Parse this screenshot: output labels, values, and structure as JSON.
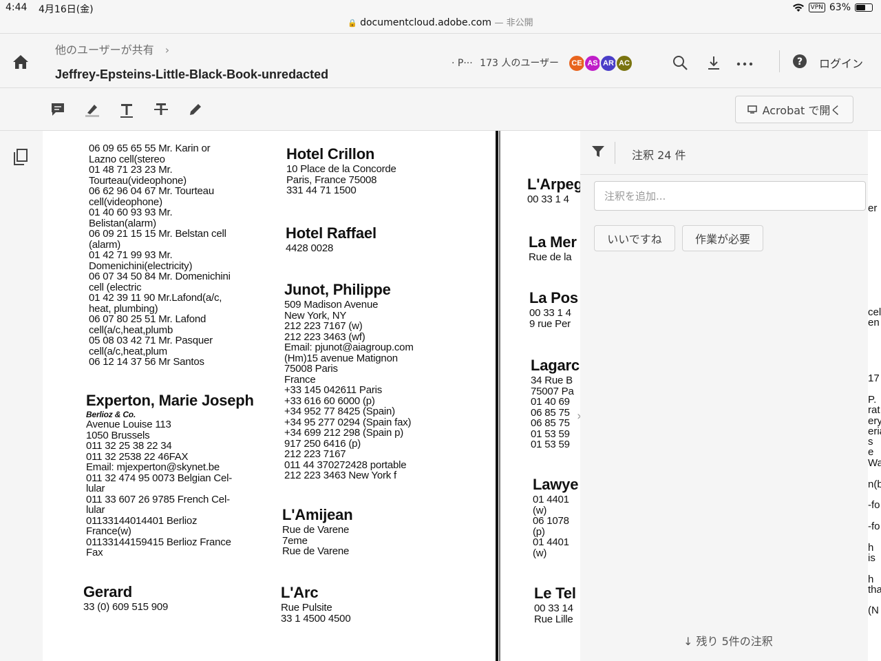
{
  "status": {
    "time": "4:44",
    "date": "4月16日(金)",
    "vpn": "VPN",
    "battery": "63%",
    "battery_level": 0.63
  },
  "browser": {
    "domain": "documentcloud.adobe.com",
    "visibility": "— 非公開"
  },
  "header": {
    "breadcrumb": "他のユーザーが共有",
    "title": "Jeffrey-Epsteins-Little-Black-Book-unredacted",
    "share_prefix": "· P···",
    "share_users": "173 人のユーザー",
    "avatars": [
      {
        "initials": "CE",
        "color": "#e8641e"
      },
      {
        "initials": "AS",
        "color": "#c01ec8"
      },
      {
        "initials": "AR",
        "color": "#4a3ec8"
      },
      {
        "initials": "AC",
        "color": "#7a7410"
      }
    ],
    "login": "ログイン"
  },
  "toolbar": {
    "open_acrobat": "Acrobat で開く"
  },
  "comments": {
    "count_label": "注釈 24 件",
    "placeholder": "注釈を追加...",
    "chip_like": "いいですね",
    "chip_needs_work": "作業が必要",
    "remaining": "残り 5件の注釈"
  },
  "document": {
    "col1": [
      "06 09 65 65 55 Mr. Karin or",
      "Lazno cell(stereo",
      "01 48 71 23 23 Mr.",
      "Tourteau(videophone)",
      "06 62 96 04 67 Mr. Tourteau",
      "cell(videophone)",
      "01 40 60 93 93 Mr.",
      "Belistan(alarm)",
      "06 09 21 15 15 Mr. Belstan cell",
      "(alarm)",
      "01 42 71 99 93 Mr.",
      "Domenichini(electricity)",
      "06 07 34 50 84 Mr. Domenichini",
      "cell (electric",
      "01 42 39 11 90 Mr.Lafond(a/c,",
      "heat, plumbing)",
      "06 07 80 25 51 Mr. Lafond",
      "cell(a/c,heat,plumb",
      "05 08 03 42 71 Mr. Pasquer",
      "cell(a/c,heat,plum",
      "06 12 14 37 56 Mr Santos"
    ],
    "experton": {
      "name": "Experton, Marie Joseph",
      "sub": "Berlioz & Co.",
      "lines": [
        "Avenue Louise 113",
        "1050 Brussels",
        "011 32 25 38 22 34",
        "011 32 2538 22 46FAX",
        "Email: mjexperton@skynet.be",
        "011 32 474 95 0073 Belgian Cel-",
        "lular",
        "011 33 607 26 9785 French Cel-",
        "lular",
        "01133144014401 Berlioz",
        "France(w)",
        "01133144159415 Berlioz France",
        "Fax"
      ]
    },
    "gerard": {
      "name": "Gerard",
      "lines": [
        "33 (0) 609 515 909"
      ]
    },
    "crillon": {
      "name": "Hotel Crillon",
      "lines": [
        "10 Place de la Concorde",
        "Paris, France 75008",
        "331 44 71 1500"
      ]
    },
    "raffael": {
      "name": "Hotel Raffael",
      "lines": [
        "4428 0028"
      ]
    },
    "junot": {
      "name": "Junot, Philippe",
      "lines": [
        "509 Madison Avenue",
        "New York, NY",
        "212 223 7167 (w)",
        "212 223 3463 (wf)",
        "Email: pjunot@aiagroup.com",
        "(Hm)15 avenue Matignon",
        "75008 Paris",
        "France",
        "+33 145 042611 Paris",
        "+33 616 60 6000 (p)",
        "+34 952 77 8425 (Spain)",
        "+34 95 277 0294 (Spain fax)",
        "+34 699 212 298 (Spain p)",
        "917 250 6416 (p)",
        "212 223 7167",
        "011 44 370272428 portable",
        "212 223 3463 New York f"
      ]
    },
    "amijean": {
      "name": "L'Amijean",
      "lines": [
        "Rue de Varene",
        "7eme",
        "Rue de Varene"
      ]
    },
    "arc": {
      "name": "L'Arc",
      "lines": [
        "Rue Pulsite",
        "33 1 4500 4500"
      ]
    },
    "col3": [
      {
        "name": "L'Arpeg",
        "lines": [
          "00 33 1 4"
        ]
      },
      {
        "name": "La Mer",
        "lines": [
          "Rue de la"
        ]
      },
      {
        "name": "La Pos",
        "lines": [
          "00 33 1 4",
          "9 rue Per"
        ]
      },
      {
        "name": "Lagarc",
        "lines": [
          "34 Rue B",
          "75007 Pa",
          "01 40 69",
          "06 85 75",
          "06 85 75",
          "01 53 59",
          "01 53 59"
        ]
      },
      {
        "name": "Lawye",
        "lines": [
          "01 4401",
          "(w)",
          "06 1078",
          "(p)",
          "01 4401",
          "(w)"
        ]
      },
      {
        "name": "Le Tel",
        "lines": [
          "00 33 14",
          "Rue Lille"
        ]
      }
    ],
    "edge": [
      "er",
      "cel",
      "en",
      "17",
      "P.",
      "rat",
      "ery",
      "eria",
      "s",
      "e",
      "Wa",
      "n(b",
      "-fo",
      "-fo",
      "h",
      "is",
      "h",
      "tha",
      "(N"
    ]
  }
}
